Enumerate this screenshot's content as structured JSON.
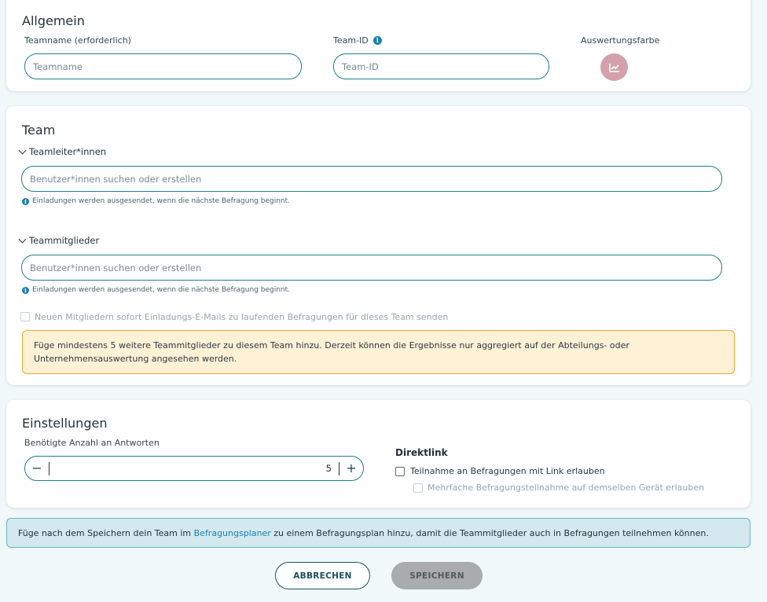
{
  "general": {
    "title": "Allgemein",
    "team_name_label": "Teamname (erforderlich)",
    "team_name_placeholder": "Teamname",
    "team_id_label": "Team-ID",
    "team_id_placeholder": "Team-ID",
    "color_label": "Auswertungsfarbe",
    "color_value": "#d4a0ac",
    "color_icon": "chart-line-icon"
  },
  "team": {
    "title": "Team",
    "leaders_label": "Teamleiter*innen",
    "leaders_placeholder": "Benutzer*innen suchen oder erstellen",
    "leaders_hint": "Einladungen werden ausgesendet, wenn die nächste Befragung beginnt.",
    "members_label": "Teammitglieder",
    "members_placeholder": "Benutzer*innen suchen oder erstellen",
    "members_hint": "Einladungen werden ausgesendet, wenn die nächste Befragung beginnt.",
    "invite_checkbox_label": "Neuen Mitgliedern sofort Einladungs-E-Mails zu laufenden Befragungen für dieses Team senden",
    "warning_text": "Füge mindestens 5 weitere Teammitglieder zu diesem Team hinzu. Derzeit können die Ergebnisse nur aggregiert auf der Abteilungs- oder Unternehmensauswertung angesehen werden."
  },
  "settings": {
    "title": "Einstellungen",
    "required_answers_label": "Benötigte Anzahl an Antworten",
    "required_answers_value": "5",
    "minus_symbol": "−",
    "plus_symbol": "+",
    "direct_link_title": "Direktlink",
    "allow_link_label": "Teilnahme an Befragungen mit Link erlauben",
    "multiple_label": "Mehrfache Befragungsteilnahme auf demselben Gerät erlauben"
  },
  "banner": {
    "text_before": "Füge nach dem Speichern dein Team im ",
    "link_text": "Befragungsplaner",
    "text_after": " zu einem Befragungsplan hinzu, damit die Teammitglieder auch in Befragungen teilnehmen können."
  },
  "actions": {
    "cancel_label": "ABBRECHEN",
    "save_label": "SPEICHERN"
  }
}
